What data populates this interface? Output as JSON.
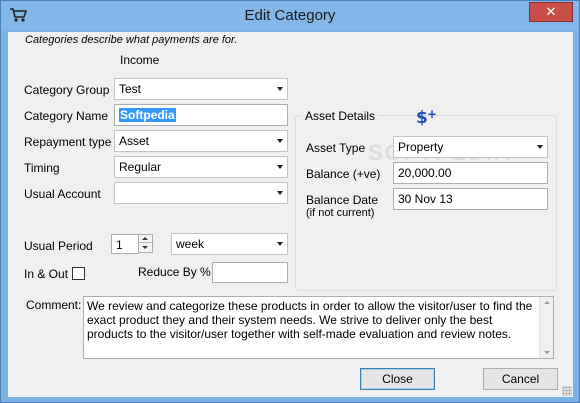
{
  "window": {
    "title": "Edit Category",
    "close_label": "✕"
  },
  "hint": "Categories describe what payments are for.",
  "category_type": "Income",
  "form": {
    "category_group": {
      "label": "Category Group",
      "value": "Test"
    },
    "category_name": {
      "label": "Category Name",
      "value": "Softpedia"
    },
    "repayment_type": {
      "label": "Repayment type",
      "value": "Asset"
    },
    "timing": {
      "label": "Timing",
      "value": "Regular"
    },
    "usual_account": {
      "label": "Usual Account",
      "value": ""
    },
    "usual_period": {
      "label": "Usual Period",
      "count": "1",
      "unit": "week"
    },
    "in_out": {
      "label": "In & Out",
      "checked": false
    },
    "reduce_by": {
      "label": "Reduce By %",
      "value": ""
    }
  },
  "asset_details": {
    "title": "Asset Details",
    "logo_icon": "dollar-plus-icon",
    "asset_type": {
      "label": "Asset Type",
      "value": "Property"
    },
    "balance": {
      "label": "Balance (+ve)",
      "value": "20,000.00"
    },
    "balance_date": {
      "label_line1": "Balance Date",
      "label_line2": "(if not current)",
      "value": "30 Nov 13"
    },
    "watermark": "SOFTPEDIA"
  },
  "comment": {
    "label": "Comment:",
    "text": "We review and categorize these products in order to allow the visitor/user to find the exact product they and their system needs. We strive to deliver only the best products to the visitor/user together with self-made evaluation and review notes."
  },
  "buttons": {
    "close": "Close",
    "cancel": "Cancel"
  },
  "colors": {
    "titlebar": "#82b8e8",
    "close_button": "#c74f48",
    "selection": "#3399ff",
    "logo": "#1f4fb5"
  }
}
